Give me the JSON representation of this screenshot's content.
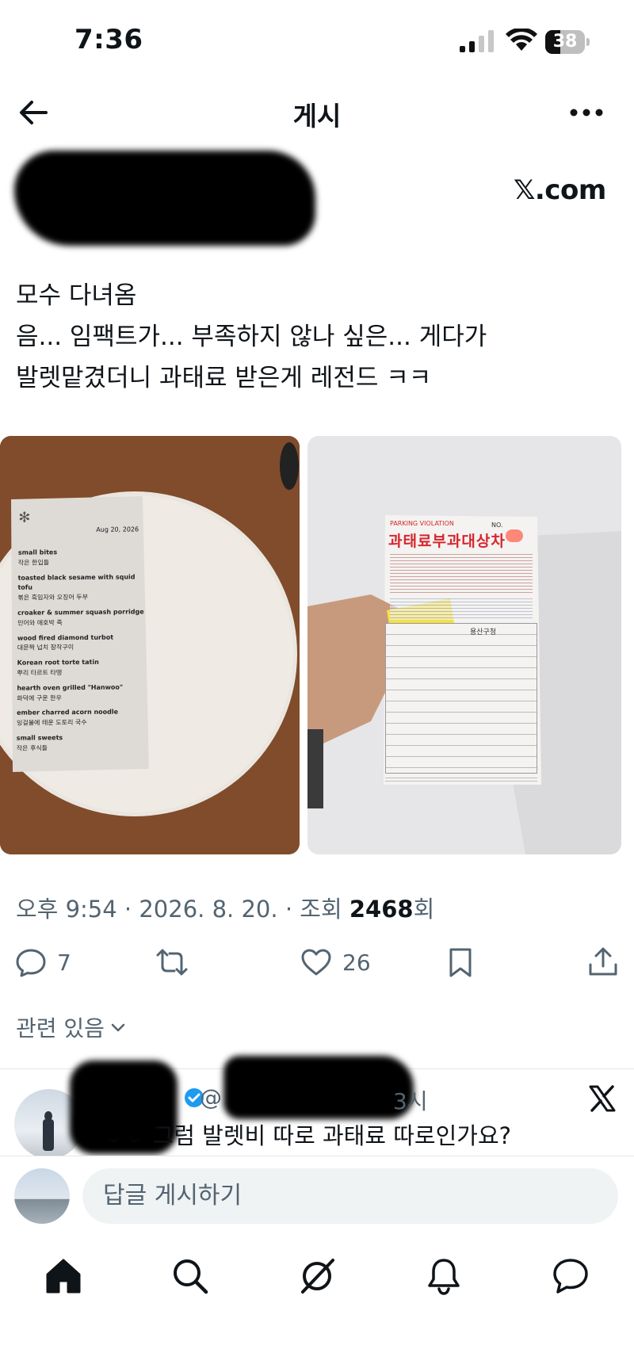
{
  "status_bar": {
    "time": "7:36",
    "battery": "38",
    "battery_level": 0.38
  },
  "header": {
    "title": "게시"
  },
  "post": {
    "source_badge": "𝕏.com",
    "text_lines": [
      "모수 다녀옴",
      "음... 임팩트가... 부족하지 않나 싶은... 게다가",
      "발렛맡겼더니 과태료 받은게 레전드 ㅋㅋ"
    ],
    "menu_card": {
      "date": "Aug 20, 2026",
      "items": [
        "small bites",
        "작은 한입들",
        "toasted black sesame with squid tofu",
        "볶은 흑임자와 오징어 두부",
        "croaker & summer squash porridge",
        "민어와 애호박 죽",
        "wood fired diamond turbot",
        "대문짝 넙치 장작구이",
        "Korean root torte tatin",
        "뿌리 타르트 타땡",
        "hearth oven grilled \"Hanwoo\"",
        "화덕에 구운 한우",
        "ember charred acorn noodle",
        "잉걸불에 태운 도토리 국수",
        "small sweets",
        "작은 후식들"
      ]
    },
    "ticket": {
      "header_en": "PARKING VIOLATION",
      "no_label": "NO.",
      "title_ko": "과태료부과대상차",
      "issuer": "용산구청"
    },
    "meta": {
      "time": "오후 9:54",
      "date": "2026. 8. 20.",
      "views_label": "조회",
      "views": "2468",
      "views_suffix": "회",
      "sep": "·"
    },
    "actions": {
      "replies": "7",
      "likes": "26"
    }
  },
  "related": {
    "label": "관련 있음"
  },
  "reply_preview": {
    "time_fragment": "3시",
    "text": "ㅎㅎ 그럼 발렛비 따로 과태료 따로인가요?"
  },
  "composer": {
    "placeholder": "답글 게시하기"
  },
  "colors": {
    "text": "#0f1419",
    "muted": "#536471",
    "verified": "#1d9bf0",
    "ticket_red": "#d7262e"
  },
  "icons": [
    "back-arrow-icon",
    "more-icon",
    "reply-icon",
    "repost-icon",
    "like-icon",
    "bookmark-icon",
    "share-icon",
    "chevron-down-icon",
    "verified-icon",
    "x-logo-icon",
    "home-icon",
    "search-icon",
    "grok-icon",
    "notifications-icon",
    "messages-icon"
  ]
}
